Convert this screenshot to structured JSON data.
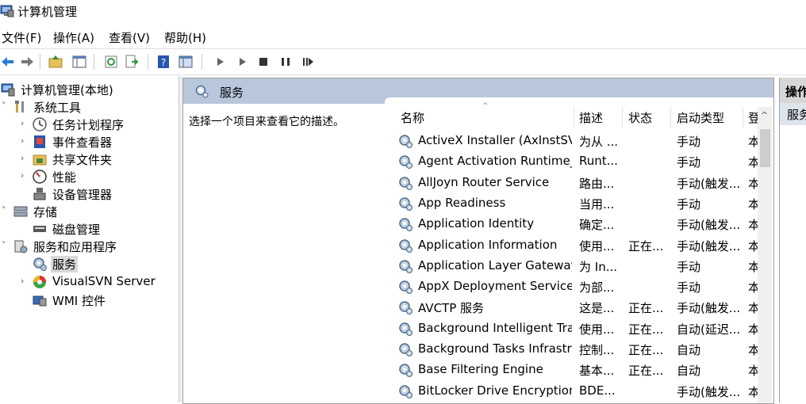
{
  "window": {
    "title": "计算机管理"
  },
  "menu": [
    "文件(F)",
    "操作(A)",
    "查看(V)",
    "帮助(H)"
  ],
  "toolbar": {
    "icons": [
      "back-icon",
      "forward-icon",
      "up-folder-icon",
      "show-hide-tree-icon",
      "refresh-icon",
      "export-icon",
      "help-icon",
      "console-tree-icon",
      "play-icon",
      "play-alt-icon",
      "stop-icon",
      "pause-icon",
      "restart-icon"
    ]
  },
  "tree": [
    {
      "label": "计算机管理(本地)",
      "icon": "computer-icon"
    },
    {
      "label": "系统工具",
      "icon": "tools-icon"
    },
    {
      "label": "任务计划程序",
      "icon": "clock-icon"
    },
    {
      "label": "事件查看器",
      "icon": "event-viewer-icon"
    },
    {
      "label": "共享文件夹",
      "icon": "shared-folder-icon"
    },
    {
      "label": "性能",
      "icon": "performance-icon"
    },
    {
      "label": "设备管理器",
      "icon": "device-manager-icon"
    },
    {
      "label": "存储",
      "icon": "storage-icon"
    },
    {
      "label": "磁盘管理",
      "icon": "disk-icon"
    },
    {
      "label": "服务和应用程序",
      "icon": "services-apps-icon"
    },
    {
      "label": "服务",
      "icon": "gear-icon"
    },
    {
      "label": "VisualSVN Server",
      "icon": "visualsvn-icon"
    },
    {
      "label": "WMI 控件",
      "icon": "wmi-icon"
    }
  ],
  "center": {
    "header": "服务",
    "description": "选择一个项目来查看它的描述。",
    "columns": [
      "名称",
      "描述",
      "状态",
      "启动类型",
      "登"
    ],
    "rows": [
      {
        "name": "ActiveX Installer (AxInstSV)",
        "desc": "为从 ...",
        "status": "",
        "startup": "手动",
        "logon": "本"
      },
      {
        "name": "Agent Activation Runtime_...",
        "desc": "Runt...",
        "status": "",
        "startup": "手动",
        "logon": "本"
      },
      {
        "name": "AllJoyn Router Service",
        "desc": "路由...",
        "status": "",
        "startup": "手动(触发...",
        "logon": "本"
      },
      {
        "name": "App Readiness",
        "desc": "当用...",
        "status": "",
        "startup": "手动",
        "logon": "本"
      },
      {
        "name": "Application Identity",
        "desc": "确定...",
        "status": "",
        "startup": "手动(触发...",
        "logon": "本"
      },
      {
        "name": "Application Information",
        "desc": "使用...",
        "status": "正在...",
        "startup": "手动(触发...",
        "logon": "本"
      },
      {
        "name": "Application Layer Gateway ...",
        "desc": "为 In...",
        "status": "",
        "startup": "手动",
        "logon": "本"
      },
      {
        "name": "AppX Deployment Service ...",
        "desc": "为部...",
        "status": "",
        "startup": "手动",
        "logon": "本"
      },
      {
        "name": "AVCTP 服务",
        "desc": "这是...",
        "status": "正在...",
        "startup": "手动(触发...",
        "logon": "本"
      },
      {
        "name": "Background Intelligent Tra...",
        "desc": "使用...",
        "status": "正在...",
        "startup": "自动(延迟...",
        "logon": "本"
      },
      {
        "name": "Background Tasks Infrastru...",
        "desc": "控制...",
        "status": "正在...",
        "startup": "自动",
        "logon": "本"
      },
      {
        "name": "Base Filtering Engine",
        "desc": "基本...",
        "status": "正在...",
        "startup": "自动",
        "logon": "本"
      },
      {
        "name": "BitLocker Drive Encryption ...",
        "desc": "BDE...",
        "status": "",
        "startup": "手动(触发...",
        "logon": "本"
      }
    ]
  },
  "actions": {
    "header": "操作",
    "item": "服务"
  },
  "colors": {
    "header_blue": "#b8c7db",
    "selection": "#d9d9d9"
  }
}
